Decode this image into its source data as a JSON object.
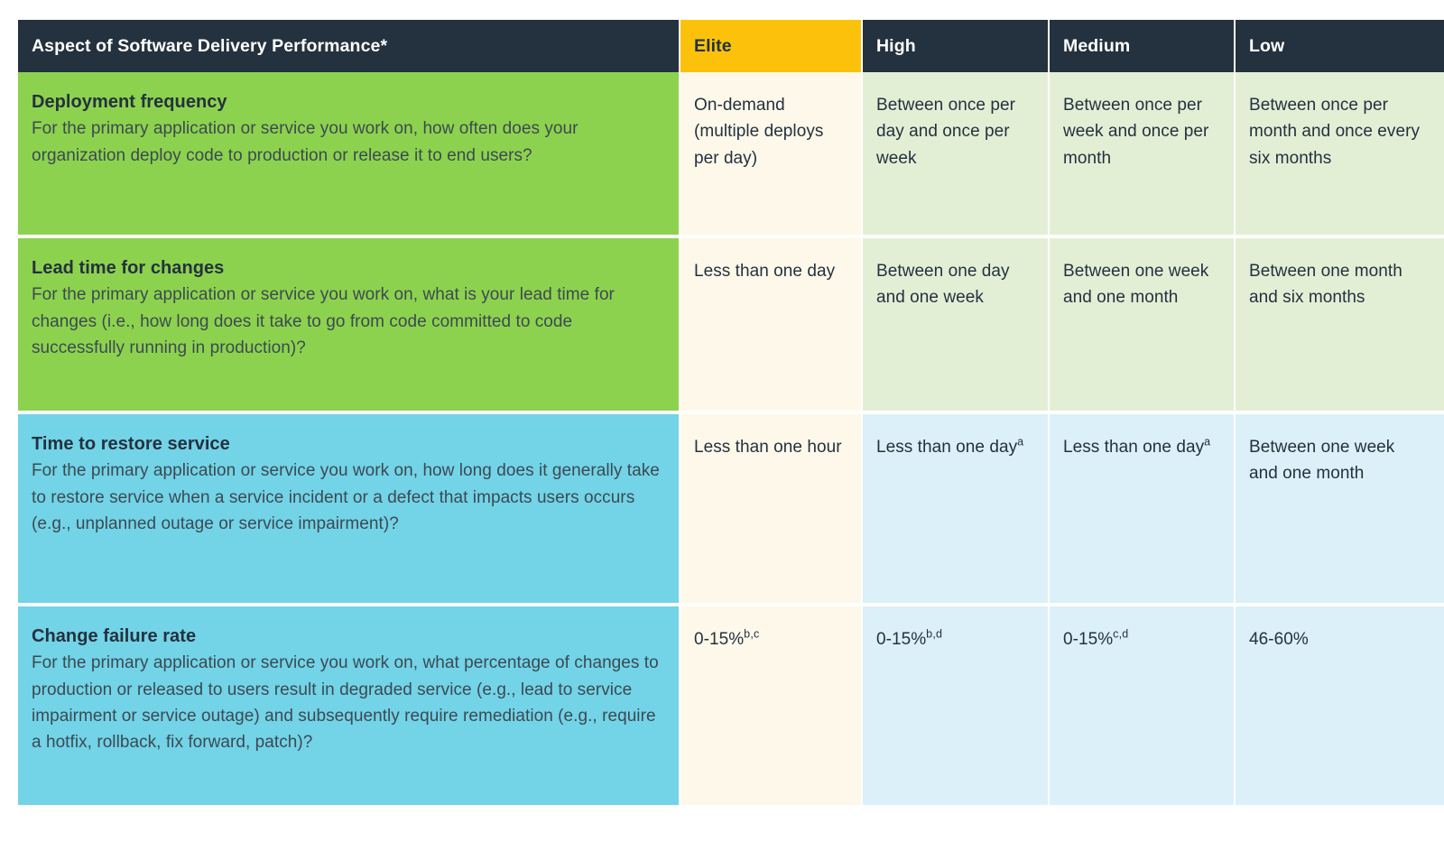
{
  "table": {
    "headers": [
      {
        "label": "Aspect of Software Delivery Performance*",
        "key": "aspect"
      },
      {
        "label": "Elite",
        "key": "elite"
      },
      {
        "label": "High",
        "key": "high"
      },
      {
        "label": "Medium",
        "key": "medium"
      },
      {
        "label": "Low",
        "key": "low"
      }
    ],
    "rows": [
      {
        "title": "Deployment frequency",
        "description": "For the primary application or service you work on, how often does your organization deploy code to production or release it to end users?",
        "theme": "green",
        "elite": "On-demand (multiple deploys per day)",
        "elite_sup": "",
        "high": "Between once per day and once per week",
        "high_sup": "",
        "medium": "Between once per week and once per month",
        "medium_sup": "",
        "low": "Between once per month and once every six months",
        "low_sup": ""
      },
      {
        "title": "Lead time for changes",
        "description": "For the primary application or service you work on, what is your lead time for changes (i.e., how long does it take to go from code committed to code successfully running in production)?",
        "theme": "green",
        "elite": "Less than one day",
        "elite_sup": "",
        "high": "Between one day and one week",
        "high_sup": "",
        "medium": "Between one week and one month",
        "medium_sup": "",
        "low": "Between one month and six months",
        "low_sup": ""
      },
      {
        "title": "Time to restore service",
        "description": "For the primary application or service you work on, how long does it generally take to restore service when a service incident or a defect that impacts users occurs (e.g., unplanned outage or service impairment)?",
        "theme": "blue",
        "elite": "Less than one hour",
        "elite_sup": "",
        "high": "Less than one day",
        "high_sup": "a",
        "medium": "Less than one day",
        "medium_sup": "a",
        "low": "Between one week and one month",
        "low_sup": ""
      },
      {
        "title": "Change failure rate",
        "description": "For the primary application or service you work on, what percentage of changes to production or released to users result in degraded service (e.g., lead to service impairment or service outage) and subsequently require remediation (e.g., require a hotfix, rollback, fix forward, patch)?",
        "theme": "blue",
        "elite": "0-15%",
        "elite_sup": "b,c",
        "high": "0-15%",
        "high_sup": "b,d",
        "medium": "0-15%",
        "medium_sup": "c,d",
        "low": "46-60%",
        "low_sup": ""
      }
    ]
  },
  "colors": {
    "header_bg": "#24313f",
    "elite_header_bg": "#fcc20b",
    "green": "#8dd24e",
    "blue": "#73d3e7",
    "cream": "#fdf8e9",
    "light_green": "#e3efd5",
    "light_blue": "#dbf0f8"
  }
}
